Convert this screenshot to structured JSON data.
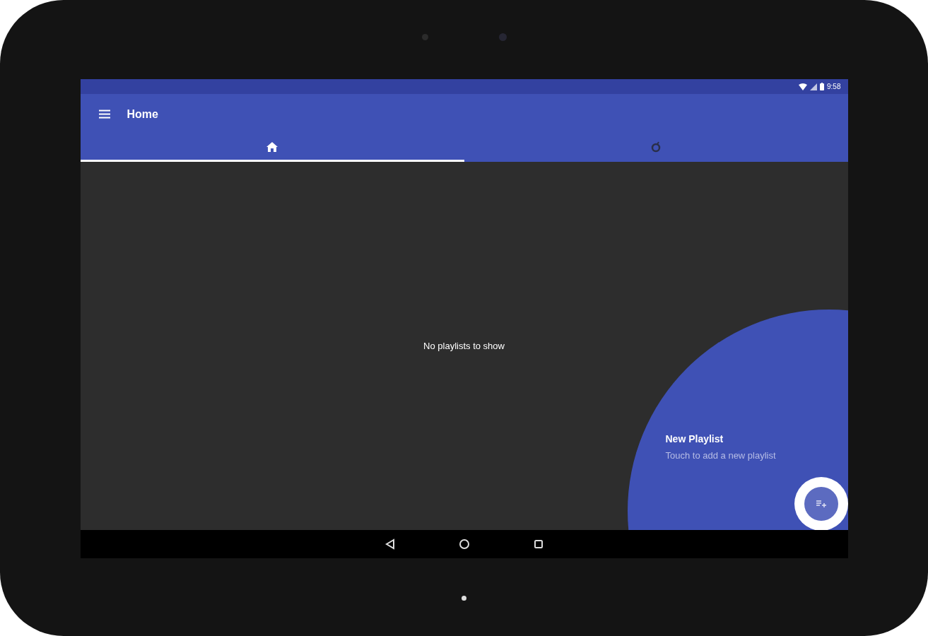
{
  "status_bar": {
    "time": "9:58"
  },
  "app_bar": {
    "title": "Home"
  },
  "tabs": [
    {
      "kind": "home",
      "selected": true
    },
    {
      "kind": "timer",
      "selected": false
    }
  ],
  "content": {
    "empty_message": "No playlists to show"
  },
  "feature_prompt": {
    "title": "New Playlist",
    "subtitle": "Touch to add a new playlist"
  }
}
